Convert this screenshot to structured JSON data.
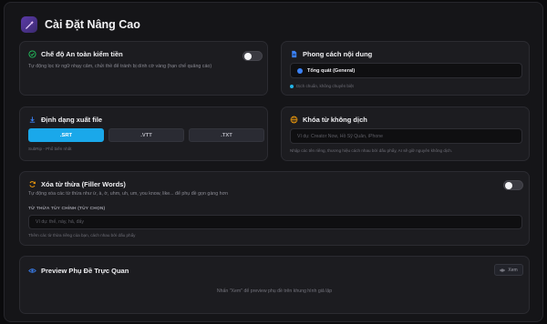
{
  "header": {
    "title": "Cài Đặt Nâng Cao",
    "logo_icon": "wand-icon"
  },
  "safe_mode": {
    "title": "Chế độ An toàn kiểm tiền",
    "description": "Tự động lọc từ ngữ nhạy cảm, chửi thề để tránh bị dính cờ vàng (hạn chế quảng cáo)",
    "enabled": false
  },
  "content_style": {
    "title": "Phong cách nội dung",
    "selected": "Tổng quát (General)",
    "hint": "Dịch chuẩn, không chuyên biệt"
  },
  "export_format": {
    "title": "Định dạng xuất file",
    "options": [
      ".SRT",
      ".VTT",
      ".TXT"
    ],
    "active": ".SRT",
    "hint": "SubRip - Phổ biến nhất"
  },
  "no_translate": {
    "title": "Khóa từ không dịch",
    "placeholder": "Ví dụ: Creator Now, Hồ Sỹ Quân, iPhone",
    "hint": "Nhập các tên riêng, thương hiệu cách nhau bởi dấu phẩy, AI sẽ giữ nguyên không dịch."
  },
  "filler": {
    "title": "Xóa từ thừa (Filler Words)",
    "description": "Tự động xóa các từ thừa như ừ, à, ờ, uhm, uh, um, you know, like... để phụ đề gọn gàng hơn",
    "enabled": false,
    "custom_label": "TỪ THỪA TÙY CHỈNH (TÙY CHỌN)",
    "placeholder": "Ví dụ: thế, này, hả, đấy",
    "hint": "Thêm các từ thừa riêng của bạn, cách nhau bởi dấu phẩy"
  },
  "preview": {
    "title": "Preview Phụ Đề Trực Quan",
    "button": "Xem",
    "hint": "Nhấn \"Xem\" để preview phụ đề trên khung hình giả lập"
  },
  "colors": {
    "accent": "#1aa8ea",
    "success": "#22c55e",
    "warning": "#f59e0b"
  }
}
